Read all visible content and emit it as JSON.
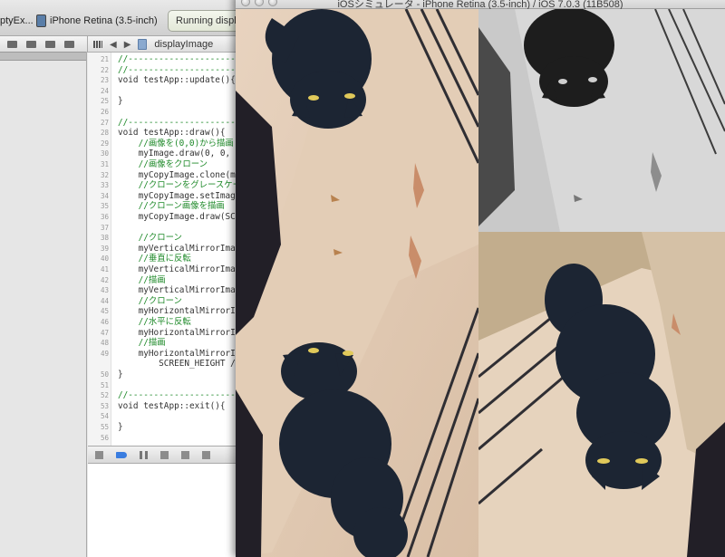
{
  "xcode": {
    "scheme_target": "ptyEx...",
    "scheme_device": "iPhone Retina (3.5-inch)",
    "activity_status": "Running displa",
    "jumpbar_file": "displayImage"
  },
  "code_lines": [
    {
      "num": "21",
      "text": "//------------------------------------",
      "cls": "cm"
    },
    {
      "num": "22",
      "text": "//------------------------------------",
      "cls": "cm"
    },
    {
      "num": "23",
      "text": "void testApp::update(){",
      "cls": "tx"
    },
    {
      "num": "24",
      "text": "",
      "cls": "tx"
    },
    {
      "num": "25",
      "text": "}",
      "cls": "tx"
    },
    {
      "num": "26",
      "text": "",
      "cls": "tx"
    },
    {
      "num": "27",
      "text": "//------------------------------------",
      "cls": "cm"
    },
    {
      "num": "28",
      "text": "void testApp::draw(){",
      "cls": "tx"
    },
    {
      "num": "29",
      "text": "    //画像を(0,0)から描画",
      "cls": "cm"
    },
    {
      "num": "30",
      "text": "    myImage.draw(0, 0, S",
      "cls": "tx"
    },
    {
      "num": "31",
      "text": "    //画像をクローン",
      "cls": "cm"
    },
    {
      "num": "32",
      "text": "    myCopyImage.clone(my",
      "cls": "tx"
    },
    {
      "num": "33",
      "text": "    //クローンをグレースケー",
      "cls": "cm"
    },
    {
      "num": "34",
      "text": "    myCopyImage.setImage",
      "cls": "tx"
    },
    {
      "num": "35",
      "text": "    //クローン画像を描画",
      "cls": "cm"
    },
    {
      "num": "36",
      "text": "    myCopyImage.draw(SCR",
      "cls": "tx"
    },
    {
      "num": "37",
      "text": "",
      "cls": "tx"
    },
    {
      "num": "38",
      "text": "    //クローン",
      "cls": "cm"
    },
    {
      "num": "39",
      "text": "    myVerticalMirrorImag",
      "cls": "tx"
    },
    {
      "num": "40",
      "text": "    //垂直に反転",
      "cls": "cm"
    },
    {
      "num": "41",
      "text": "    myVerticalMirrorImag",
      "cls": "tx"
    },
    {
      "num": "42",
      "text": "    //描画",
      "cls": "cm"
    },
    {
      "num": "43",
      "text": "    myVerticalMirrorImag",
      "cls": "tx"
    },
    {
      "num": "44",
      "text": "    //クローン",
      "cls": "cm"
    },
    {
      "num": "45",
      "text": "    myHorizontalMirrorIm",
      "cls": "tx"
    },
    {
      "num": "46",
      "text": "    //水平に反転",
      "cls": "cm"
    },
    {
      "num": "47",
      "text": "    myHorizontalMirrorIm",
      "cls": "tx"
    },
    {
      "num": "48",
      "text": "    //描画",
      "cls": "cm"
    },
    {
      "num": "49",
      "text": "    myHorizontalMirrorIm",
      "cls": "tx"
    },
    {
      "num": "",
      "text": "        SCREEN_HEIGHT /",
      "cls": "tx"
    },
    {
      "num": "50",
      "text": "}",
      "cls": "tx"
    },
    {
      "num": "51",
      "text": "",
      "cls": "tx"
    },
    {
      "num": "52",
      "text": "//------------------------------------",
      "cls": "cm"
    },
    {
      "num": "53",
      "text": "void testApp::exit(){",
      "cls": "tx"
    },
    {
      "num": "54",
      "text": "",
      "cls": "tx"
    },
    {
      "num": "55",
      "text": "}",
      "cls": "tx"
    },
    {
      "num": "56",
      "text": "",
      "cls": "tx"
    }
  ],
  "simulator": {
    "title": "iOSシミュレータ - iPhone Retina (3.5-inch) / iOS 7.0.3 (11B508)"
  }
}
